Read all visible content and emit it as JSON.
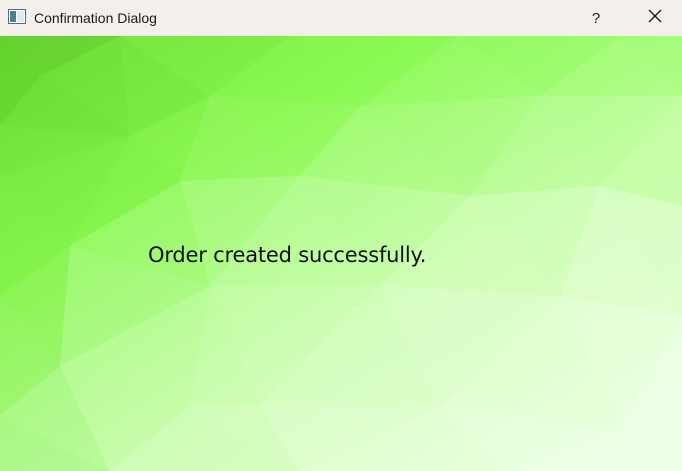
{
  "window": {
    "title": "Confirmation Dialog",
    "help_glyph": "?",
    "icons": {
      "app": "window-icon",
      "close": "close-icon"
    }
  },
  "dialog": {
    "message": "Order created successfully."
  },
  "colors": {
    "titlebar": "#f3f0eb",
    "background_dark_green": "#5fd12a",
    "background_light_green": "#efffe6",
    "text": "#111111"
  }
}
